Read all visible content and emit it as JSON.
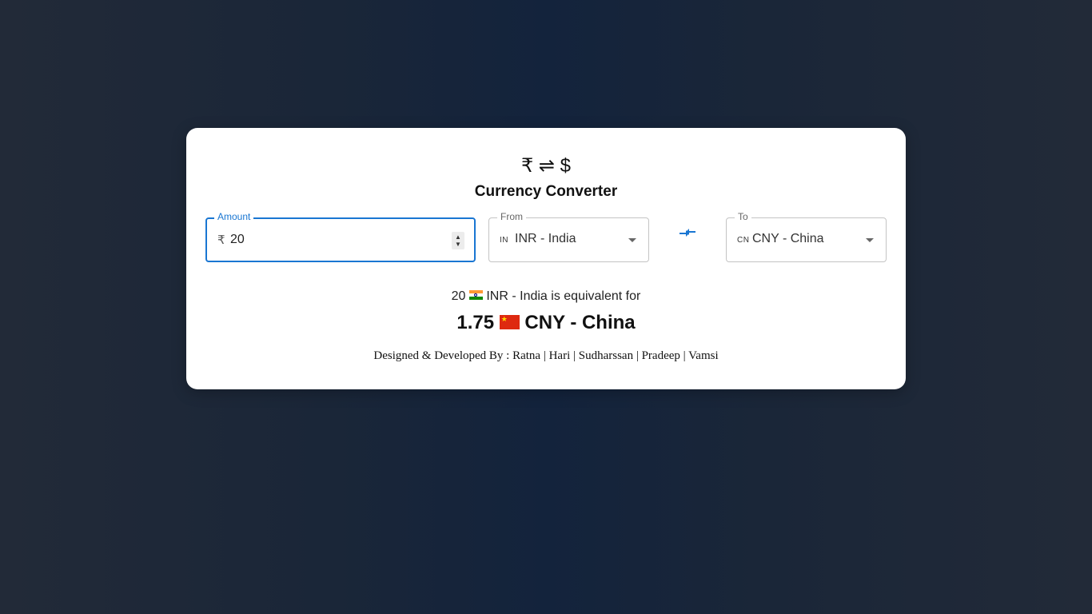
{
  "header": {
    "logo_text": "₹ ⇌ $",
    "title": "Currency Converter"
  },
  "amount": {
    "label": "Amount",
    "currency_symbol": "₹",
    "value": "20"
  },
  "from": {
    "label": "From",
    "code": "IN",
    "value": "INR - India"
  },
  "to": {
    "label": "To",
    "code": "CN",
    "value": "CNY - China"
  },
  "swap": {
    "icon": "swap-arrows-icon",
    "color": "#1976d2"
  },
  "summary": {
    "amount": "20",
    "from_currency": "INR - India",
    "text": "is equivalent for"
  },
  "result": {
    "amount": "1.75",
    "to_currency": "CNY - China"
  },
  "footer": {
    "credits": "Designed & Developed By : Ratna | Hari | Sudharssan | Pradeep | Vamsi"
  },
  "colors": {
    "accent": "#1976d2",
    "card": "#ffffff"
  }
}
